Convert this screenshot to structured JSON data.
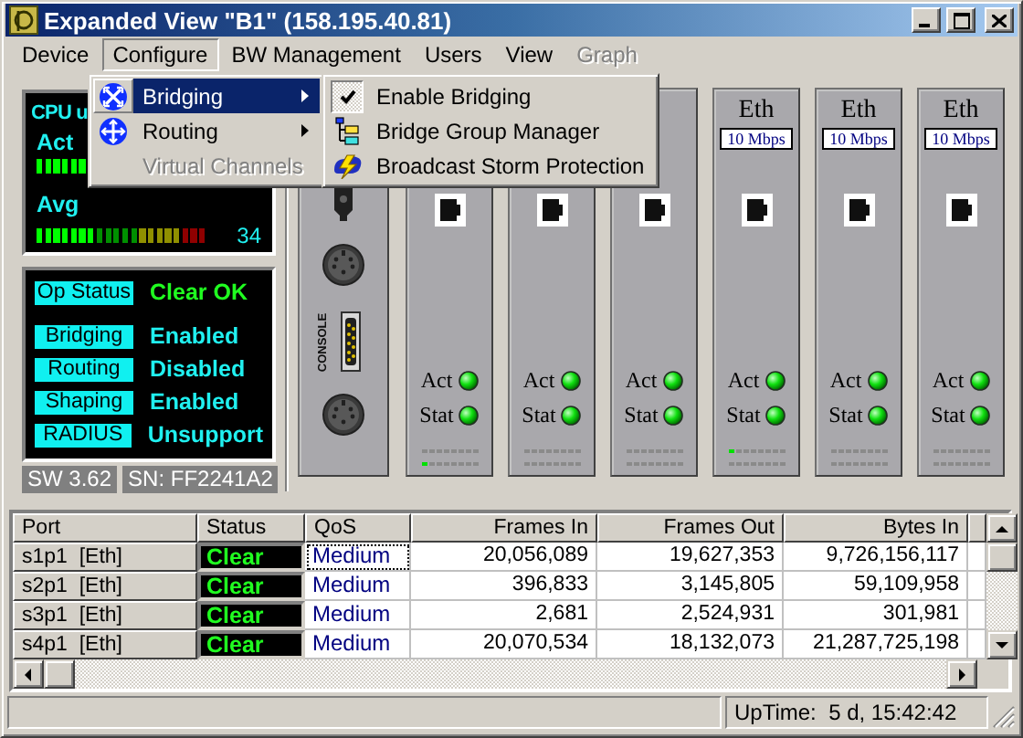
{
  "window": {
    "title": "Expanded View \"B1\" (158.195.40.81)"
  },
  "menu_bar": [
    {
      "label": "Device",
      "selected": false,
      "disabled": false
    },
    {
      "label": "Configure",
      "selected": true,
      "disabled": false
    },
    {
      "label": "BW Management",
      "selected": false,
      "disabled": false
    },
    {
      "label": "Users",
      "selected": false,
      "disabled": false
    },
    {
      "label": "View",
      "selected": false,
      "disabled": false
    },
    {
      "label": "Graph",
      "selected": false,
      "disabled": true
    }
  ],
  "configure_menu": [
    {
      "label": "Bridging",
      "kind": "bridge",
      "selected": true,
      "disabled": false,
      "submenu": true
    },
    {
      "label": "Routing",
      "kind": "route",
      "selected": false,
      "disabled": false,
      "submenu": true
    },
    {
      "label": "Virtual Channels",
      "kind": "plain",
      "selected": false,
      "disabled": true,
      "submenu": false
    }
  ],
  "bridging_submenu": [
    {
      "label": "Enable Bridging",
      "kind": "check",
      "checked": true
    },
    {
      "label": "Bridge Group Manager",
      "kind": "tree"
    },
    {
      "label": "Broadcast Storm Protection",
      "kind": "storm"
    }
  ],
  "cpu": {
    "title": "CPU u",
    "act": {
      "label": "Act",
      "level": 0.3
    },
    "avg": {
      "label": "Avg",
      "level": 0.35,
      "reading": "34"
    }
  },
  "status_panel": [
    {
      "kind": "op",
      "label": "Op Status",
      "value": "Clear OK"
    },
    {
      "kind": "feature",
      "label": "Bridging",
      "value": "Enabled"
    },
    {
      "kind": "feature",
      "label": "Routing",
      "value": "Disabled"
    },
    {
      "kind": "feature",
      "label": "Shaping",
      "value": "Enabled"
    },
    {
      "kind": "feature",
      "label": "RADIUS",
      "value": "Unsupport"
    }
  ],
  "version": {
    "software": "SW 3.62",
    "serial": "SN: FF2241A2"
  },
  "console_module": {
    "label": "CONSOLE"
  },
  "eth_modules": [
    {
      "act_label": "Act",
      "stat_label": "Stat",
      "act_lit": true,
      "stat_lit": true,
      "upper_activity": false,
      "lower_activity": true
    },
    {
      "act_label": "Act",
      "stat_label": "Stat",
      "act_lit": true,
      "stat_lit": true,
      "upper_activity": false,
      "lower_activity": false
    },
    {
      "act_label": "Act",
      "stat_label": "Stat",
      "act_lit": true,
      "stat_lit": true,
      "upper_activity": false,
      "lower_activity": false
    },
    {
      "name": "Eth",
      "speed": "10 Mbps",
      "act_label": "Act",
      "stat_label": "Stat",
      "act_lit": true,
      "stat_lit": true,
      "upper_activity": true,
      "lower_activity": false
    },
    {
      "name": "Eth",
      "speed": "10 Mbps",
      "act_label": "Act",
      "stat_label": "Stat",
      "act_lit": true,
      "stat_lit": true,
      "upper_activity": false,
      "lower_activity": false
    },
    {
      "name": "Eth",
      "speed": "10 Mbps",
      "act_label": "Act",
      "stat_label": "Stat",
      "act_lit": true,
      "stat_lit": true,
      "upper_activity": false,
      "lower_activity": false
    }
  ],
  "table": {
    "columns": [
      {
        "label": "Port",
        "kind": "row_header"
      },
      {
        "label": "Status",
        "kind": "status"
      },
      {
        "label": "QoS",
        "kind": "qos"
      },
      {
        "label": "Frames In",
        "kind": "number"
      },
      {
        "label": "Frames Out",
        "kind": "number"
      },
      {
        "label": "Bytes In",
        "kind": "number"
      }
    ],
    "rows": [
      {
        "selected": true,
        "cells": [
          "s1p1  [Eth]",
          "Clear",
          "Medium",
          "20,056,089",
          "19,627,353",
          "9,726,156,117"
        ]
      },
      {
        "selected": false,
        "cells": [
          "s2p1  [Eth]",
          "Clear",
          "Medium",
          "396,833",
          "3,145,805",
          "59,109,958"
        ]
      },
      {
        "selected": false,
        "cells": [
          "s3p1  [Eth]",
          "Clear",
          "Medium",
          "2,681",
          "2,524,931",
          "301,981"
        ]
      },
      {
        "selected": false,
        "cells": [
          "s4p1  [Eth]",
          "Clear",
          "Medium",
          "20,070,534",
          "18,132,073",
          "21,287,725,198"
        ]
      }
    ]
  },
  "status_bar": {
    "uptime": "UpTime:  5 d, 15:42:42"
  }
}
